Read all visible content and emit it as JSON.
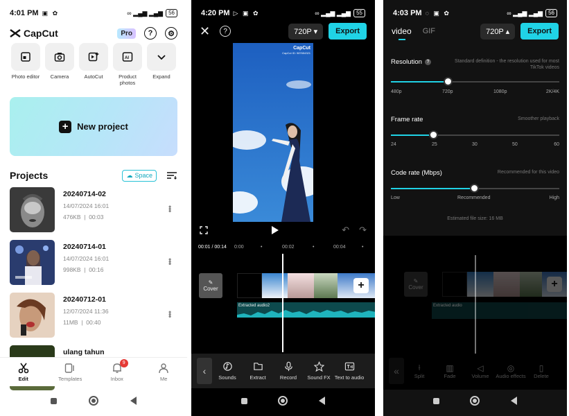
{
  "colors": {
    "accent": "#20d3e6",
    "dark_bg": "#000000",
    "settings_bg": "#121212",
    "badge_red": "#e53935"
  },
  "home": {
    "status": {
      "time": "4:01 PM",
      "battery": "56"
    },
    "app_name": "CapCut",
    "pro_label": "Pro",
    "tools": [
      {
        "label": "Photo editor",
        "icon": "photo-editor-icon"
      },
      {
        "label": "Camera",
        "icon": "camera-icon"
      },
      {
        "label": "AutoCut",
        "icon": "autocut-icon"
      },
      {
        "label": "Product photos",
        "icon": "product-photos-icon"
      },
      {
        "label": "Expand",
        "icon": "chevron-down-icon"
      }
    ],
    "new_project_label": "New project",
    "projects_title": "Projects",
    "space_label": "Space",
    "projects": [
      {
        "name": "20240714-02",
        "date": "14/07/2024 16:01",
        "size": "476KB",
        "duration": "00:03"
      },
      {
        "name": "20240714-01",
        "date": "14/07/2024 16:01",
        "size": "998KB",
        "duration": "00:16"
      },
      {
        "name": "20240712-01",
        "date": "12/07/2024 11:36",
        "size": "11MB",
        "duration": "00:40"
      },
      {
        "name": "ulang tahun",
        "date": "",
        "size": "",
        "duration": ""
      }
    ],
    "nav": [
      {
        "label": "Edit",
        "icon": "scissors-icon"
      },
      {
        "label": "Templates",
        "icon": "templates-icon"
      },
      {
        "label": "Inbox",
        "icon": "bell-icon",
        "badge": "9"
      },
      {
        "label": "Me",
        "icon": "person-icon"
      }
    ]
  },
  "editor": {
    "status": {
      "time": "4:20 PM",
      "battery": "55"
    },
    "resolution_label": "720P",
    "export_label": "Export",
    "watermark": "CapCut",
    "watermark_sub": "CapCut ID: 987654321",
    "timecode": "00:01 / 00:14",
    "ruler_marks": [
      "0:00",
      "00:02",
      "00:04"
    ],
    "cover_label": "Cover",
    "audio_label": "Extracted audio2",
    "tools": [
      {
        "label": "Sounds",
        "icon": "sounds-icon"
      },
      {
        "label": "Extract",
        "icon": "extract-icon"
      },
      {
        "label": "Record",
        "icon": "microphone-icon"
      },
      {
        "label": "Sound FX",
        "icon": "sound-fx-icon"
      },
      {
        "label": "Text to audio",
        "icon": "text-to-audio-icon"
      }
    ]
  },
  "export_settings": {
    "status": {
      "time": "4:03 PM",
      "battery": "56"
    },
    "tab_video": "video",
    "tab_gif": "GIF",
    "resolution_label": "720P",
    "export_label": "Export",
    "resolution": {
      "title": "Resolution",
      "desc": "Standard definition - the resolution used for most TikTok videos",
      "ticks": [
        "480p",
        "720p",
        "1080p",
        "2K/4K"
      ],
      "value_index": 1
    },
    "frame_rate": {
      "title": "Frame rate",
      "desc": "Smoother playback",
      "ticks": [
        "24",
        "25",
        "30",
        "50",
        "60"
      ],
      "value_index": 1
    },
    "code_rate": {
      "title": "Code rate (Mbps)",
      "desc": "Recommended for this video",
      "ticks": [
        "Low",
        "Recommended",
        "High"
      ],
      "value_index": 1
    },
    "estimated": "Estimated file size: 16 MB",
    "cover_label": "Cover",
    "audio_label": "Extracted audio",
    "dim_tools": [
      {
        "label": "Split",
        "icon": "split-icon"
      },
      {
        "label": "Fade",
        "icon": "fade-icon"
      },
      {
        "label": "Volume",
        "icon": "volume-icon"
      },
      {
        "label": "Audio effects",
        "icon": "audio-effects-icon"
      },
      {
        "label": "Delete",
        "icon": "trash-icon"
      }
    ]
  }
}
